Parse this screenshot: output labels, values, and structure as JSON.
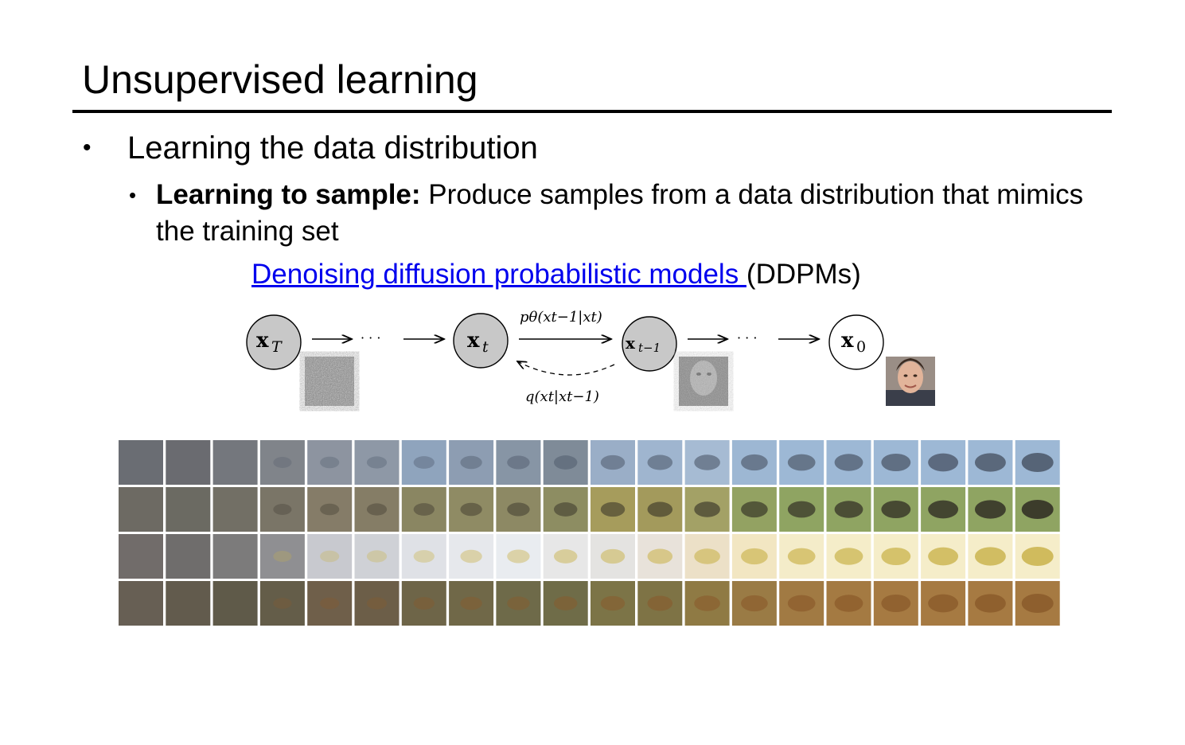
{
  "slide": {
    "title": "Unsupervised learning",
    "bullet1": "Learning the data distribution",
    "bullet2_bold": "Learning to sample:",
    "bullet2_text": " Produce samples from a data distribution that mimics the training set",
    "link_text": "Denoising diffusion probabilistic models ",
    "link_suffix": "(DDPMs)",
    "link_color": "#0000ee"
  },
  "diagram": {
    "nodes": [
      {
        "label": "x",
        "sub": "T",
        "fill": "#c8c8c8"
      },
      {
        "label": "x",
        "sub": "t",
        "fill": "#c8c8c8"
      },
      {
        "label": "x",
        "sub": "t−1",
        "fill": "#c8c8c8"
      },
      {
        "label": "x",
        "sub": "0",
        "fill": "#ffffff"
      }
    ],
    "dots": "· · ·",
    "reverse_label": "pθ(xt−1|xt)",
    "forward_label": "q(xt|xt−1)"
  },
  "sample_grid": {
    "rows": [
      "airplane",
      "ostrich",
      "yellow-plane",
      "frog"
    ],
    "columns": 20,
    "colors": {
      "airplane": [
        "#6a6d73",
        "#6a6b70",
        "#74777d",
        "#80848a",
        "#8d94a0",
        "#8e98a6",
        "#8fa4bd",
        "#8d9db2",
        "#8795a5",
        "#7f8b98",
        "#9aaec7",
        "#9fb5cf",
        "#a6bbd3",
        "#9db7d3",
        "#9db8d5",
        "#9db8d5",
        "#9db8d5",
        "#9db8d5",
        "#9db8d5",
        "#9db8d5"
      ],
      "ostrich": [
        "#6d6a63",
        "#6b6a62",
        "#726f65",
        "#7a7567",
        "#857c68",
        "#857d66",
        "#8a8662",
        "#8f8b64",
        "#8d8964",
        "#8d8d62",
        "#a69c5c",
        "#a39a5c",
        "#a3a166",
        "#93a262",
        "#8fa462",
        "#8fa462",
        "#8fa462",
        "#8fa462",
        "#8fa462",
        "#8fa462"
      ],
      "yellow-plane": [
        "#716c6a",
        "#6f6d6c",
        "#7c7b7b",
        "#8f8f92",
        "#c8c9cf",
        "#cfd1d6",
        "#dfe1e6",
        "#e6e8ec",
        "#e9ecf0",
        "#e7e7e7",
        "#e4e3e1",
        "#e8e2da",
        "#ece0c7",
        "#f2e6c2",
        "#f4ecc9",
        "#f5edc9",
        "#f5edc9",
        "#f5edc9",
        "#f5edc9",
        "#f5edc9"
      ],
      "frog": [
        "#675f54",
        "#625b4d",
        "#5f5a49",
        "#645d49",
        "#6f5f4a",
        "#6c5e48",
        "#6e6548",
        "#706848",
        "#6e6a49",
        "#6f6c48",
        "#7c7447",
        "#7e7345",
        "#8f7a44",
        "#9a7b45",
        "#a17a43",
        "#a47a42",
        "#a67a42",
        "#a67a42",
        "#a67a42",
        "#a67a42"
      ]
    }
  }
}
